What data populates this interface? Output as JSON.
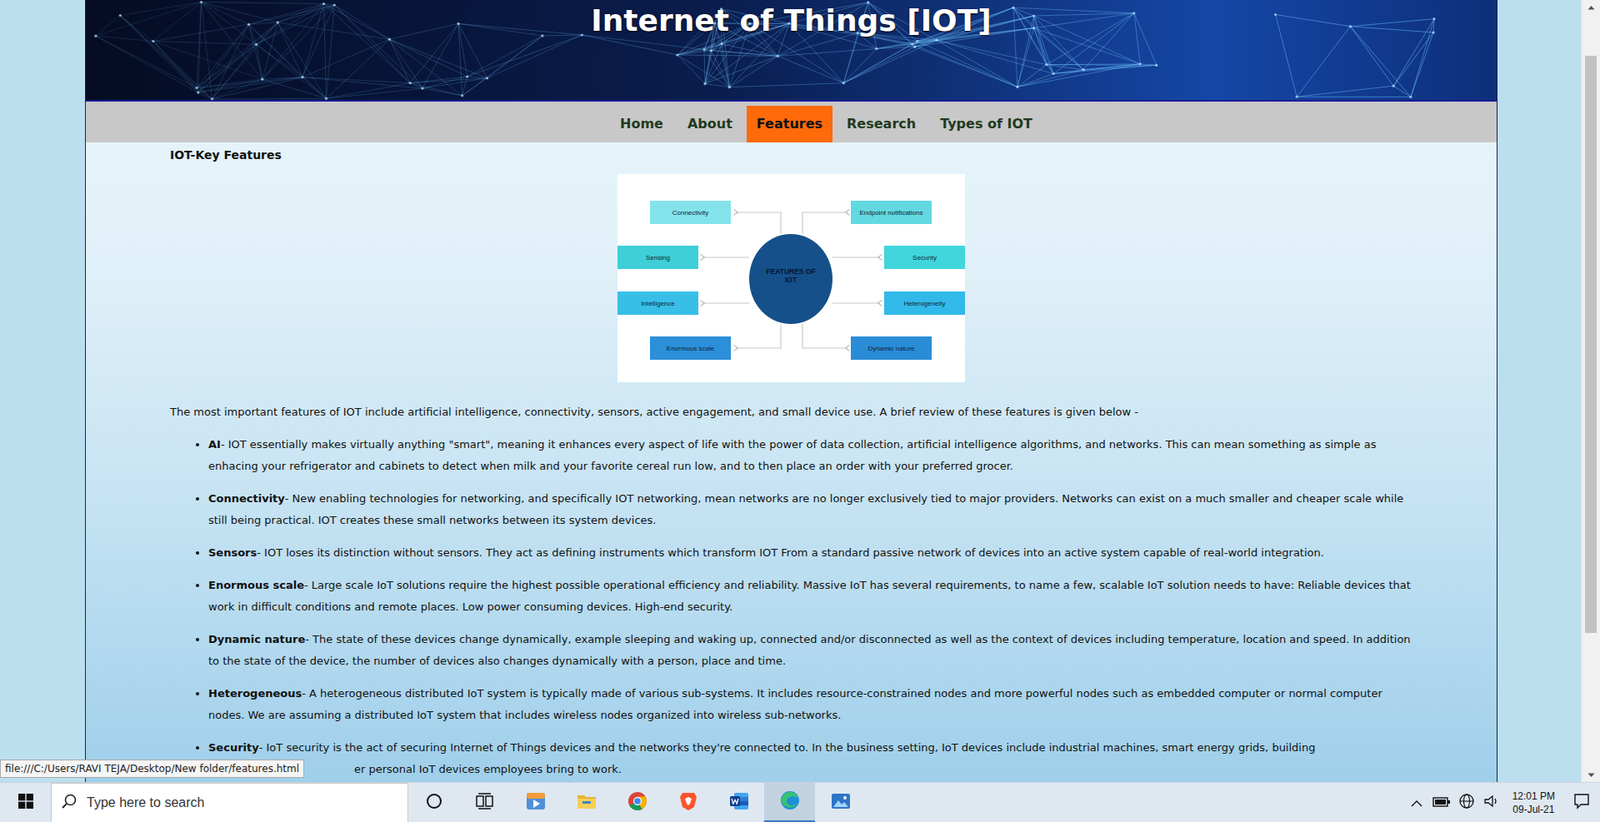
{
  "page": {
    "title": "Internet of Things [IOT]",
    "nav": [
      {
        "label": "Home",
        "selected": false
      },
      {
        "label": "About",
        "selected": false
      },
      {
        "label": "Features",
        "selected": true
      },
      {
        "label": "Research",
        "selected": false
      },
      {
        "label": "Types of IOT",
        "selected": false
      }
    ],
    "heading": "IOT-Key Features",
    "diagram": {
      "center": "FEATURES OF IOT",
      "left": [
        {
          "label": "Connectivity",
          "color": "#84e3ea"
        },
        {
          "label": "Sensing",
          "color": "#3ecfd8"
        },
        {
          "label": "Intelligence",
          "color": "#37bfe8"
        },
        {
          "label": "Enormous scale",
          "color": "#2b8fd9"
        }
      ],
      "right": [
        {
          "label": "Endpoint notifications",
          "color": "#62d9e1"
        },
        {
          "label": "Security",
          "color": "#40d6dc"
        },
        {
          "label": "Heterogeneity",
          "color": "#31b9e9"
        },
        {
          "label": "Dynamic nature",
          "color": "#2a8cd6"
        }
      ]
    },
    "intro": "The most important features of IOT include artificial intelligence, connectivity, sensors, active engagement, and small device use. A brief review of these features is given below -",
    "features": [
      {
        "term": "AI",
        "text": "- IOT essentially makes virtually anything \"smart\", meaning it enhances every aspect of life with the power of data collection, artificial intelligence algorithms, and networks. This can mean something as simple as enhacing your refrigerator and cabinets to detect when milk and your favorite cereal run low, and to then place an order with your preferred grocer."
      },
      {
        "term": "Connectivity",
        "text": "- New enabling technologies for networking, and specifically IOT networking, mean networks are no longer exclusively tied to major providers. Networks can exist on a much smaller and cheaper scale while still being practical. IOT creates these small networks between its system devices."
      },
      {
        "term": "Sensors",
        "text": "- IOT loses its distinction without sensors. They act as defining instruments which transform IOT From a standard passive network of devices into an active system capable of real-world integration."
      },
      {
        "term": "Enormous scale",
        "text": "- Large scale IoT solutions require the highest possible operational efficiency and reliability. Massive IoT has several requirements, to name a few, scalable IoT solution needs to have: Reliable devices that work in difficult conditions and remote places. Low power consuming devices. High-end security."
      },
      {
        "term": "Dynamic nature",
        "text": "- The state of these devices change dynamically, example sleeping and waking up, connected and/or disconnected as well as the context of devices including temperature, location and speed. In addition to the state of the device, the number of devices also changes dynamically with a person, place and time."
      },
      {
        "term": "Heterogeneous",
        "text": "- A heterogeneous distributed IoT system is typically made of various sub-systems. It includes resource-constrained nodes and more powerful nodes such as embedded computer or normal computer nodes. We are assuming a distributed IoT system that includes wireless nodes organized into wireless sub-networks."
      },
      {
        "term": "Security",
        "text": "- IoT security is the act of securing Internet of Things devices and the networks they're connected to. In the business setting, IoT devices include industrial machines, smart energy grids, building",
        "tail": "er personal IoT devices employees bring to work."
      }
    ]
  },
  "status_tooltip": "file:///C:/Users/RAVI TEJA/Desktop/New folder/features.html",
  "taskbar": {
    "search_placeholder": "Type here to search",
    "apps": [
      {
        "kind": "media",
        "active": false
      },
      {
        "kind": "explorer",
        "active": false
      },
      {
        "kind": "chrome",
        "active": false
      },
      {
        "kind": "brave",
        "active": false
      },
      {
        "kind": "word",
        "active": false
      },
      {
        "kind": "edge",
        "active": true
      },
      {
        "kind": "photos",
        "active": false
      }
    ],
    "time": "12:01 PM",
    "date": "09-Jul-21"
  }
}
